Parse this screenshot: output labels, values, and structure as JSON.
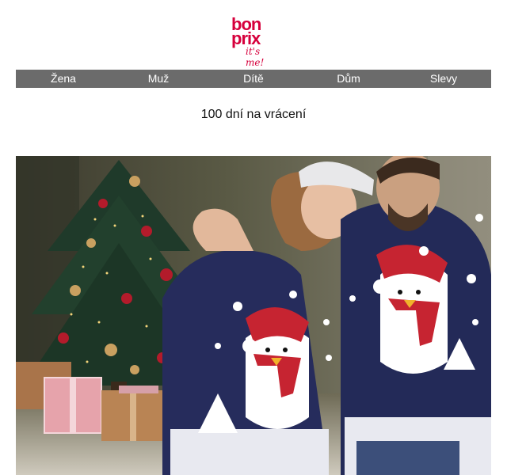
{
  "brand": {
    "line1": "bon",
    "line2": "prix",
    "slogan": "it's me!",
    "color": "#d6003c"
  },
  "nav": {
    "background": "#6b6b6b",
    "items": [
      {
        "label": "Žena"
      },
      {
        "label": "Muž"
      },
      {
        "label": "Dítě"
      },
      {
        "label": "Dům"
      },
      {
        "label": "Slevy"
      }
    ]
  },
  "tagline": "100 dní na vrácení",
  "hero": {
    "icon": "christmas-sweater-couple-photo"
  }
}
